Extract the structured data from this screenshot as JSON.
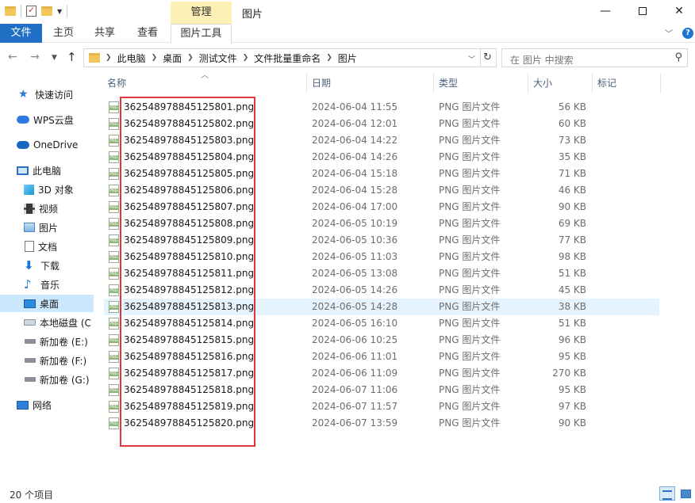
{
  "window": {
    "title": "图片",
    "manage_tab": "管理"
  },
  "ribbon": {
    "tabs": [
      "文件",
      "主页",
      "共享",
      "查看",
      "图片工具"
    ]
  },
  "address": {
    "crumbs": [
      "此电脑",
      "桌面",
      "测试文件",
      "文件批量重命名",
      "图片"
    ],
    "search_placeholder": "在 图片 中搜索"
  },
  "nav": {
    "items": [
      {
        "label": "快速访问",
        "icon": "star-icon"
      },
      {
        "label": "WPS云盘",
        "icon": "wps-cloud-icon"
      },
      {
        "label": "OneDrive",
        "icon": "onedrive-cloud-icon"
      },
      {
        "label": "此电脑",
        "icon": "computer-icon"
      },
      {
        "label": "3D 对象",
        "icon": "3d-objects-icon"
      },
      {
        "label": "视频",
        "icon": "video-icon"
      },
      {
        "label": "图片",
        "icon": "pictures-icon"
      },
      {
        "label": "文档",
        "icon": "documents-icon"
      },
      {
        "label": "下载",
        "icon": "download-icon"
      },
      {
        "label": "音乐",
        "icon": "music-icon"
      },
      {
        "label": "桌面",
        "icon": "desktop-icon"
      },
      {
        "label": "本地磁盘 (C",
        "icon": "local-disk-icon"
      },
      {
        "label": "新加卷 (E:)",
        "icon": "drive-icon"
      },
      {
        "label": "新加卷 (F:)",
        "icon": "drive-icon"
      },
      {
        "label": "新加卷 (G:)",
        "icon": "drive-icon"
      },
      {
        "label": "网络",
        "icon": "network-icon"
      }
    ],
    "selected": "桌面"
  },
  "list": {
    "columns": [
      "名称",
      "日期",
      "类型",
      "大小",
      "标记"
    ],
    "rows": [
      {
        "name": "362548978845125801.png",
        "date": "2024-06-04 11:55",
        "type": "PNG 图片文件",
        "size": "56 KB"
      },
      {
        "name": "362548978845125802.png",
        "date": "2024-06-04 12:01",
        "type": "PNG 图片文件",
        "size": "60 KB"
      },
      {
        "name": "362548978845125803.png",
        "date": "2024-06-04 14:22",
        "type": "PNG 图片文件",
        "size": "73 KB"
      },
      {
        "name": "362548978845125804.png",
        "date": "2024-06-04 14:26",
        "type": "PNG 图片文件",
        "size": "35 KB"
      },
      {
        "name": "362548978845125805.png",
        "date": "2024-06-04 15:18",
        "type": "PNG 图片文件",
        "size": "71 KB"
      },
      {
        "name": "362548978845125806.png",
        "date": "2024-06-04 15:28",
        "type": "PNG 图片文件",
        "size": "46 KB"
      },
      {
        "name": "362548978845125807.png",
        "date": "2024-06-04 17:00",
        "type": "PNG 图片文件",
        "size": "90 KB"
      },
      {
        "name": "362548978845125808.png",
        "date": "2024-06-05 10:19",
        "type": "PNG 图片文件",
        "size": "69 KB"
      },
      {
        "name": "362548978845125809.png",
        "date": "2024-06-05 10:36",
        "type": "PNG 图片文件",
        "size": "77 KB"
      },
      {
        "name": "362548978845125810.png",
        "date": "2024-06-05 11:03",
        "type": "PNG 图片文件",
        "size": "98 KB"
      },
      {
        "name": "362548978845125811.png",
        "date": "2024-06-05 13:08",
        "type": "PNG 图片文件",
        "size": "51 KB"
      },
      {
        "name": "362548978845125812.png",
        "date": "2024-06-05 14:26",
        "type": "PNG 图片文件",
        "size": "45 KB"
      },
      {
        "name": "362548978845125813.png",
        "date": "2024-06-05 14:28",
        "type": "PNG 图片文件",
        "size": "38 KB"
      },
      {
        "name": "362548978845125814.png",
        "date": "2024-06-05 16:10",
        "type": "PNG 图片文件",
        "size": "51 KB"
      },
      {
        "name": "362548978845125815.png",
        "date": "2024-06-06 10:25",
        "type": "PNG 图片文件",
        "size": "96 KB"
      },
      {
        "name": "362548978845125816.png",
        "date": "2024-06-06 11:01",
        "type": "PNG 图片文件",
        "size": "95 KB"
      },
      {
        "name": "362548978845125817.png",
        "date": "2024-06-06 11:09",
        "type": "PNG 图片文件",
        "size": "270 KB"
      },
      {
        "name": "362548978845125818.png",
        "date": "2024-06-07 11:06",
        "type": "PNG 图片文件",
        "size": "95 KB"
      },
      {
        "name": "362548978845125819.png",
        "date": "2024-06-07 11:57",
        "type": "PNG 图片文件",
        "size": "97 KB"
      },
      {
        "name": "362548978845125820.png",
        "date": "2024-06-07 13:59",
        "type": "PNG 图片文件",
        "size": "90 KB"
      }
    ],
    "hovered_row": "362548978845125813.png"
  },
  "status": {
    "count": "20 个项目"
  },
  "colors": {
    "accent": "#1e6fc5",
    "manage_tab": "#fcf0b4",
    "selection": "#cce8ff",
    "hover": "#e5f3ff",
    "annotation_box": "#e2343c"
  }
}
